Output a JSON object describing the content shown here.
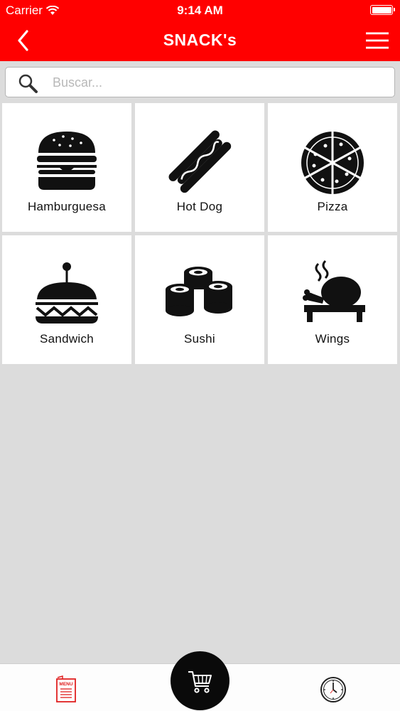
{
  "status_bar": {
    "carrier": "Carrier",
    "time": "9:14 AM",
    "icons": [
      "wifi-icon",
      "battery-icon"
    ]
  },
  "nav": {
    "title": "SNACK's",
    "back_icon": "chevron-left-icon",
    "menu_icon": "hamburger-menu-icon",
    "color": "#ff0000"
  },
  "search": {
    "placeholder": "Buscar...",
    "value": "",
    "icon": "search-icon"
  },
  "categories": [
    {
      "label": "Hamburguesa",
      "icon": "burger-icon"
    },
    {
      "label": "Hot Dog",
      "icon": "hotdog-icon"
    },
    {
      "label": "Pizza",
      "icon": "pizza-icon"
    },
    {
      "label": "Sandwich",
      "icon": "sandwich-icon"
    },
    {
      "label": "Sushi",
      "icon": "sushi-icon"
    },
    {
      "label": "Wings",
      "icon": "roast-chicken-icon"
    }
  ],
  "tab_bar": {
    "menu_icon": "menu-card-icon",
    "menu_icon_text": "MENU",
    "cart_icon": "cart-icon",
    "clock_icon": "clock-icon",
    "accent": "#e02020"
  }
}
